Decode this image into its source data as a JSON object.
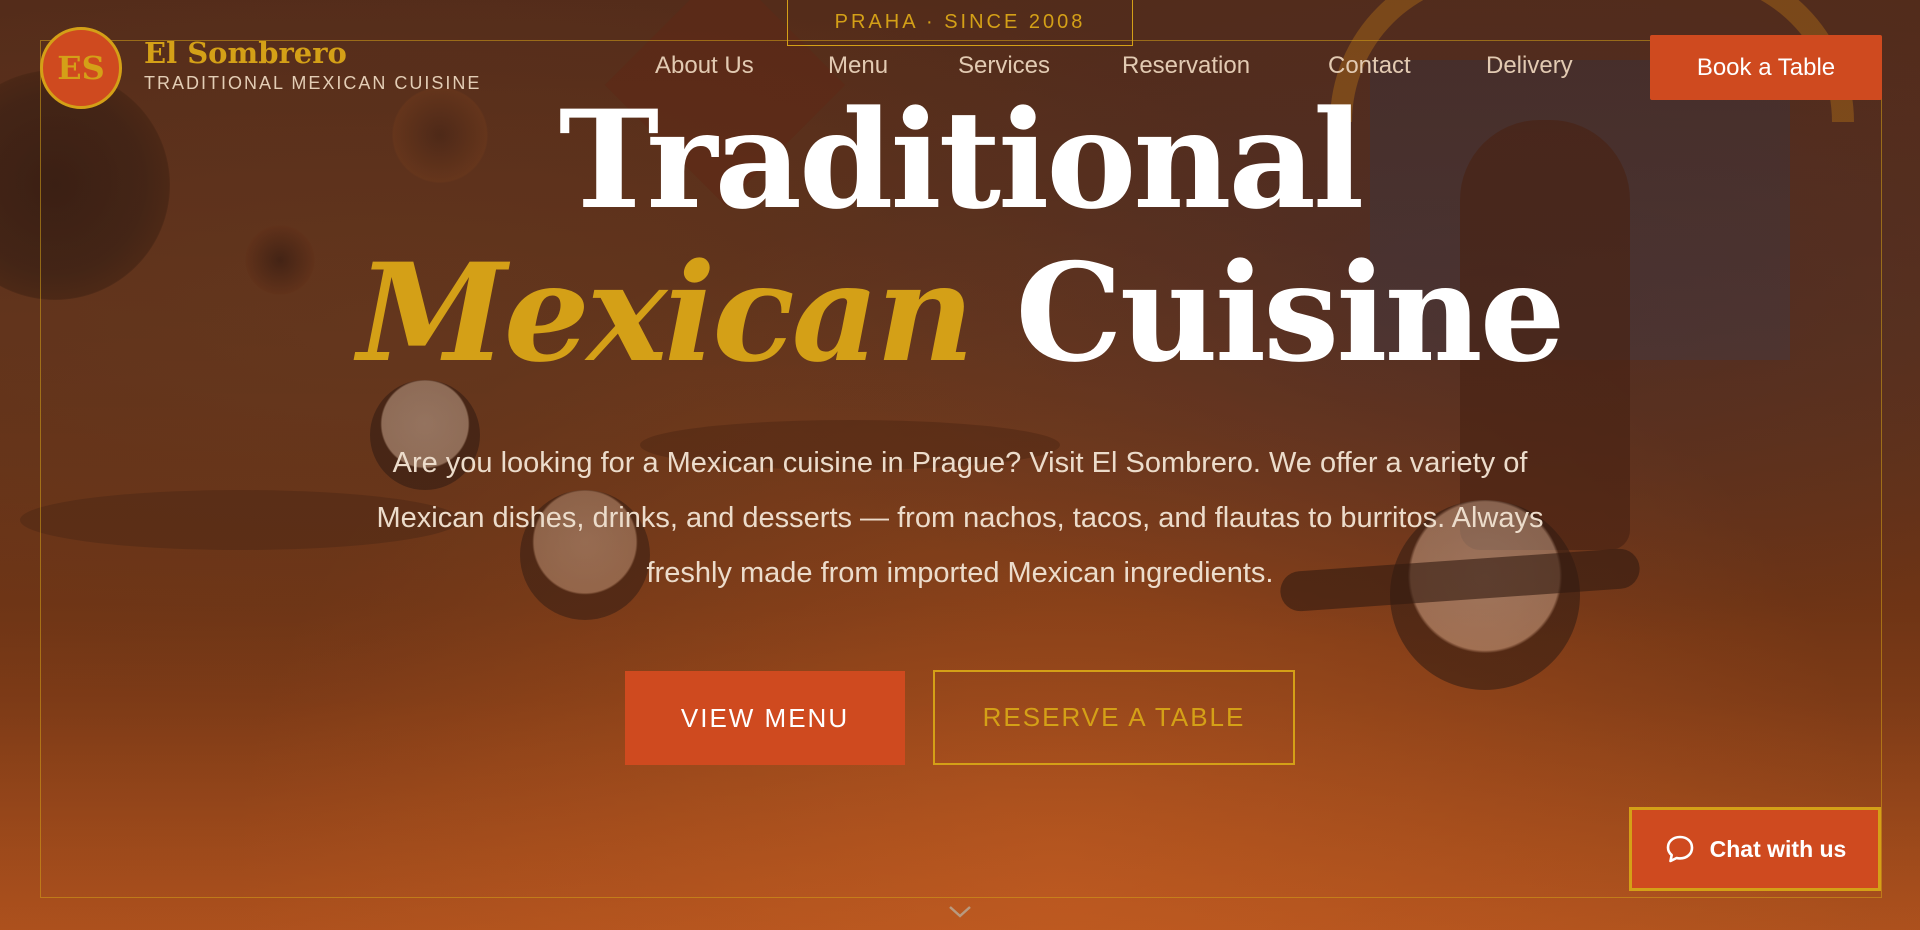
{
  "brand": {
    "badge": "ES",
    "name": "El Sombrero",
    "tagline": "TRADITIONAL MEXICAN CUISINE"
  },
  "since_label": "PRAHA · SINCE 2008",
  "nav": {
    "items": [
      {
        "label": "About Us"
      },
      {
        "label": "Menu"
      },
      {
        "label": "Services"
      },
      {
        "label": "Reservation"
      },
      {
        "label": "Contact"
      },
      {
        "label": "Delivery"
      }
    ],
    "cta_label": "Book a Table"
  },
  "hero": {
    "title_line1": "Traditional",
    "title_accent": "Mexican",
    "title_rest": "Cuisine",
    "description": "Are you looking for a Mexican cuisine in Prague? Visit El Sombrero. We offer a variety of Mexican dishes, drinks, and desserts — from nachos, tacos, and flautas to burritos. Always freshly made from imported Mexican ingredients.",
    "primary_button": "VIEW MENU",
    "secondary_button": "RESERVE A TABLE"
  },
  "chat": {
    "label": "Chat with us",
    "icon": "chat-bubble-icon"
  },
  "icons": {
    "scroll": "chevron-down-icon"
  },
  "colors": {
    "accent_gold": "#d4a017",
    "brand_orange": "#cf4a1f",
    "text_light": "#ecdccb"
  }
}
